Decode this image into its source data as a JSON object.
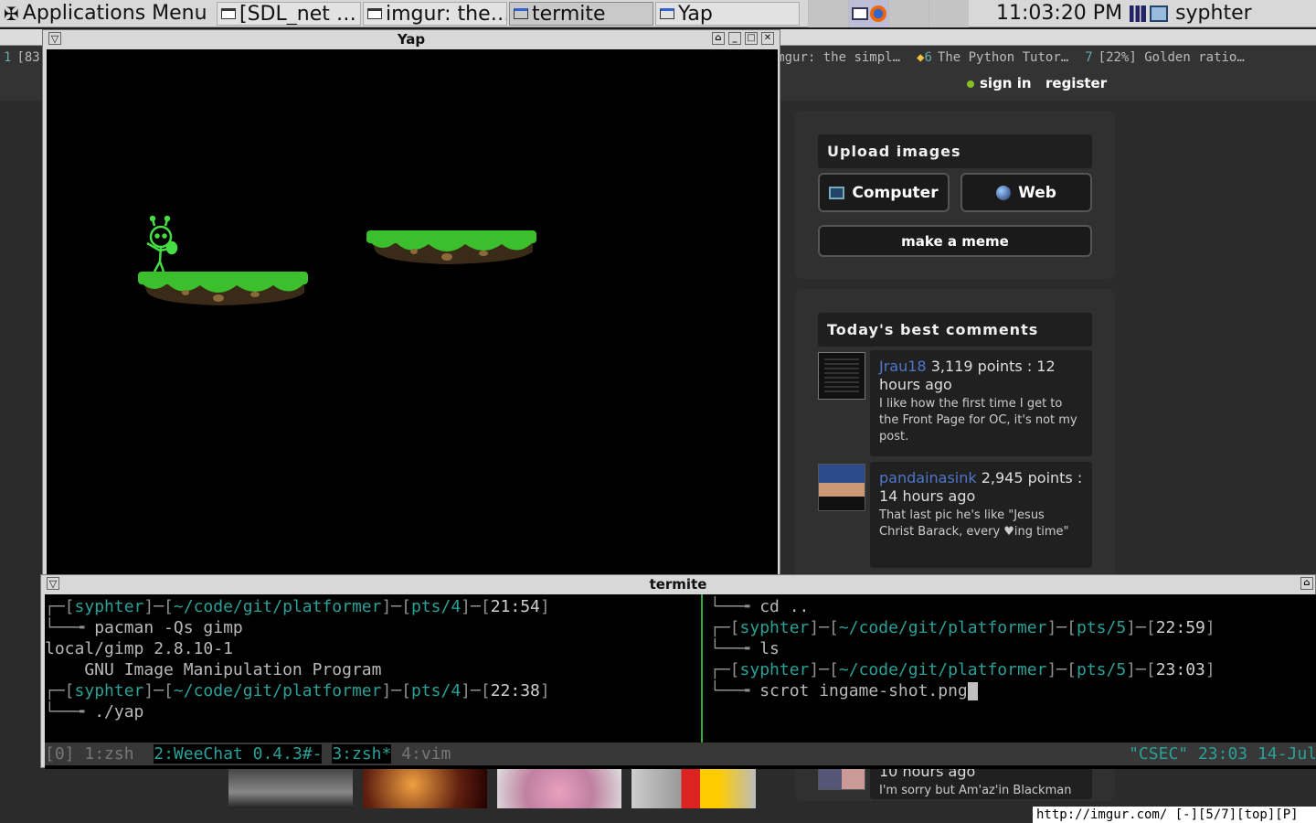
{
  "panel": {
    "apps_menu": "Applications Menu",
    "tasks": [
      {
        "label": "[SDL_net …",
        "active": false,
        "icon": "terminal-icon"
      },
      {
        "label": "imgur: the…",
        "active": false,
        "icon": "terminal-icon"
      },
      {
        "label": "termite",
        "active": true,
        "icon": "window-icon"
      },
      {
        "label": "Yap",
        "active": false,
        "icon": "window-icon"
      }
    ],
    "clock": "11:03:20 PM",
    "user": "syphter"
  },
  "browser": {
    "tabs": [
      {
        "num": "1",
        "label": "[83"
      },
      {
        "num": "",
        "label": "imgur: the simpl…"
      },
      {
        "num": "6",
        "label": "The Python Tutor…"
      },
      {
        "num": "7",
        "label": "[22%] Golden ratio…"
      }
    ],
    "nav": {
      "sign_in": "sign in",
      "register": "register"
    },
    "upload": {
      "heading": "Upload images",
      "computer": "Computer",
      "web": "Web",
      "meme": "make a meme"
    },
    "comments": {
      "heading": "Today's best comments",
      "items": [
        {
          "user": "Jrau18",
          "meta": "3,119 points : 12 hours ago",
          "text": "I like how the first time I get to the Front Page for OC, it's not my post."
        },
        {
          "user": "pandainasink",
          "meta": "2,945 points : 14 hours ago",
          "text": "That last pic he's like \"Jesus Christ Barack, every ♥ing time\""
        },
        {
          "meta": "10 hours ago",
          "text": "I'm sorry but Am'az'in Blackman"
        }
      ]
    },
    "status": "http://imgur.com/  [-][5/7][top][P]"
  },
  "yap": {
    "title": "Yap"
  },
  "termite": {
    "title": "termite",
    "left": [
      {
        "user": "syphter",
        "path": "~/code/git/platformer",
        "pts": "pts/4",
        "time": "21:54",
        "cmd": "pacman -Qs gimp"
      },
      {
        "out1": "local/gimp 2.8.10-1",
        "out2": "    GNU Image Manipulation Program"
      },
      {
        "user": "syphter",
        "path": "~/code/git/platformer",
        "pts": "pts/4",
        "time": "22:38",
        "cmd": "./yap"
      }
    ],
    "right_first_cmd": "cd ..",
    "right": [
      {
        "user": "syphter",
        "path": "~/code/git/platformer",
        "pts": "pts/5",
        "time": "22:59",
        "cmd": "ls"
      },
      {
        "user": "syphter",
        "path": "~/code/git/platformer",
        "pts": "pts/5",
        "time": "23:03",
        "cmd": "scrot ingame-shot.png"
      }
    ],
    "tmux": {
      "session": "[0]",
      "w1": "1:zsh",
      "w2": "2:WeeChat 0.4.3#-",
      "w3": "3:zsh*",
      "w4": "4:vim",
      "right": "\"CSEC\" 23:03 14-Jul"
    }
  }
}
